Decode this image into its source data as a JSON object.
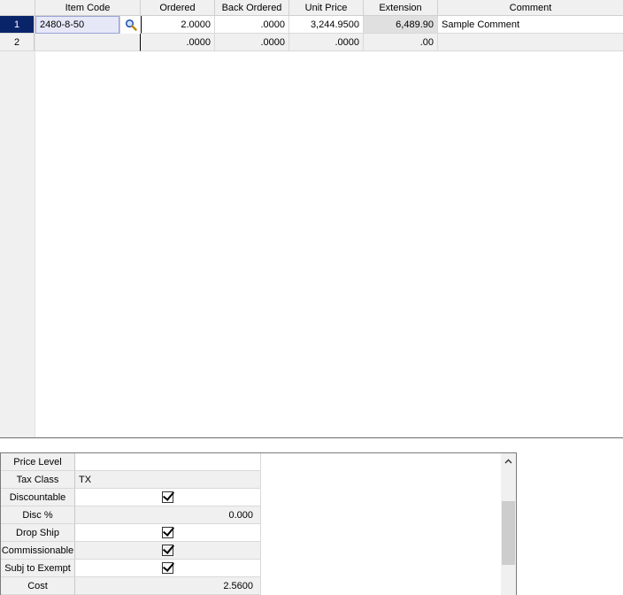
{
  "grid": {
    "columns": {
      "item_code": "Item Code",
      "ordered": "Ordered",
      "back_ordered": "Back Ordered",
      "unit_price": "Unit Price",
      "extension": "Extension",
      "comment": "Comment"
    },
    "rows": [
      {
        "num": "1",
        "item_code": "2480-8-50",
        "ordered": "2.0000",
        "back_ordered": ".0000",
        "unit_price": "3,244.9500",
        "extension": "6,489.90",
        "comment": "Sample Comment"
      },
      {
        "num": "2",
        "item_code": "",
        "ordered": ".0000",
        "back_ordered": ".0000",
        "unit_price": ".0000",
        "extension": ".00",
        "comment": ""
      }
    ]
  },
  "properties": {
    "price_level": {
      "label": "Price Level",
      "value": ""
    },
    "tax_class": {
      "label": "Tax Class",
      "value": "TX"
    },
    "discountable": {
      "label": "Discountable",
      "checked": true
    },
    "disc_pct": {
      "label": "Disc %",
      "value": "0.000"
    },
    "drop_ship": {
      "label": "Drop Ship",
      "checked": true
    },
    "commissionable": {
      "label": "Commissionable",
      "checked": true
    },
    "subj_to_exempt": {
      "label": "Subj to Exempt",
      "checked": true
    },
    "cost": {
      "label": "Cost",
      "value": "2.5600"
    }
  },
  "colors": {
    "selected_row": "#0a246a",
    "item_code_cell": "#e6e8f8",
    "extension_cell": "#e0e0e0"
  },
  "icons": {
    "lookup": "magnifier-icon",
    "scroll_up": "chevron-up-icon"
  }
}
